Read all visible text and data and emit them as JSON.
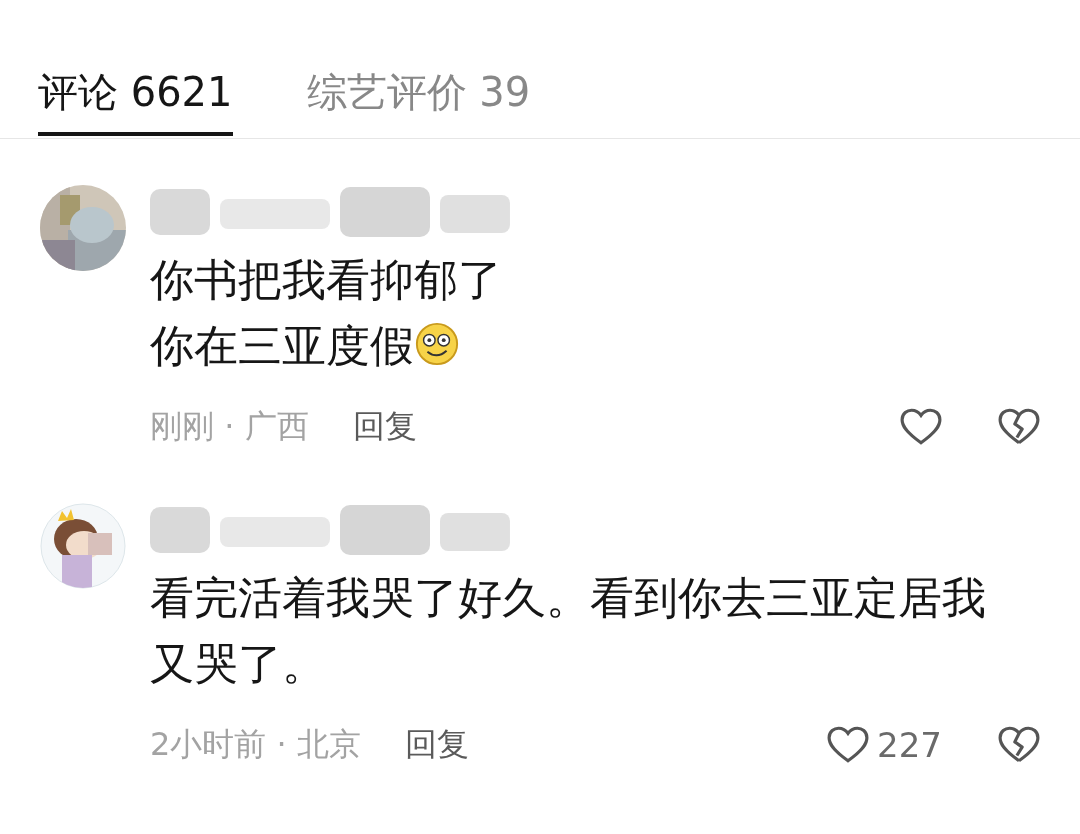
{
  "tabs": [
    {
      "label": "评论 6621",
      "selected": true
    },
    {
      "label": "综艺评价 39",
      "selected": false
    }
  ],
  "comments": [
    {
      "avatar": {
        "kind": "picture"
      },
      "lines": [
        "你书把我看抑郁了",
        "你在三亚度假"
      ],
      "emoji": true,
      "time_location": "刚刚 · 广西",
      "reply": "回复",
      "liked": false
    },
    {
      "avatar": {
        "kind": "picture"
      },
      "lines": [
        "看完活着我哭了好久。看到你去三亚定居我又哭了。"
      ],
      "emoji": false,
      "time_location": "2小时前 · 北京",
      "reply": "回复",
      "likes": "227",
      "liked": false
    }
  ]
}
